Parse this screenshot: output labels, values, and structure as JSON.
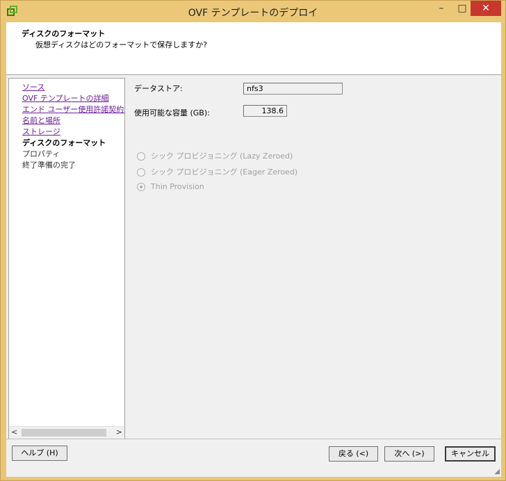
{
  "window": {
    "title": "OVF テンプレートのデプロイ",
    "controls": {
      "minimize": "–",
      "maximize": "□",
      "close": "✕"
    }
  },
  "header": {
    "title": "ディスクのフォーマット",
    "subtitle": "仮想ディスクはどのフォーマットで保存しますか?"
  },
  "nav": {
    "items": [
      {
        "label": "ソース",
        "state": "link"
      },
      {
        "label": "OVF テンプレートの詳細",
        "state": "link"
      },
      {
        "label": "エンド ユーザー使用許諾契約書",
        "state": "link"
      },
      {
        "label": "名前と場所",
        "state": "link"
      },
      {
        "label": "ストレージ",
        "state": "link"
      },
      {
        "label": "ディスクのフォーマット",
        "state": "current"
      },
      {
        "label": "プロパティ",
        "state": "pending"
      },
      {
        "label": "終了準備の完了",
        "state": "pending"
      }
    ],
    "scroll_left": "<",
    "scroll_right": ">"
  },
  "form": {
    "datastore_label": "データストア:",
    "datastore_value": "nfs3",
    "capacity_label": "使用可能な容量 (GB):",
    "capacity_value": "138.6",
    "options": [
      {
        "label": "シック プロビジョニング (Lazy Zeroed)",
        "checked": false
      },
      {
        "label": "シック プロビジョニング (Eager Zeroed)",
        "checked": false
      },
      {
        "label": "Thin Provision",
        "checked": true
      }
    ]
  },
  "footer": {
    "help": "ヘルプ (H)",
    "back": "戻る (<)",
    "next": "次へ (>)",
    "cancel": "キャンセル"
  },
  "colors": {
    "frame": "#e9c676",
    "close": "#c7372d",
    "link": "#6a1b9a"
  }
}
